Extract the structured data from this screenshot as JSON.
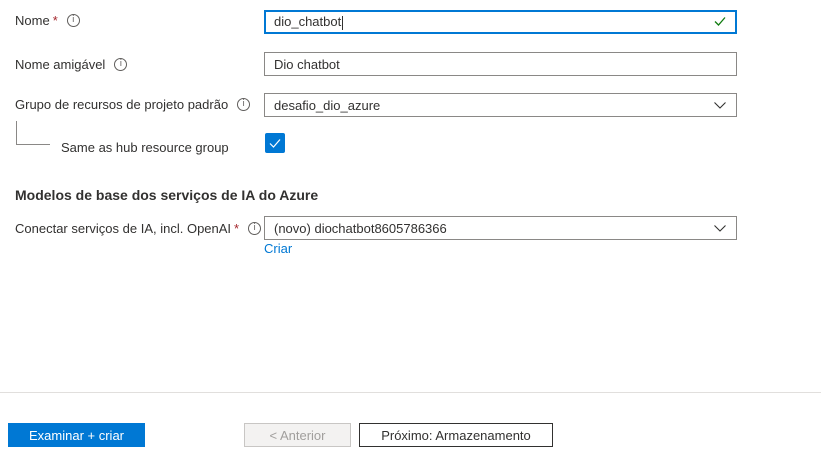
{
  "form": {
    "name": {
      "label": "Nome",
      "required_mark": "*",
      "info_icon": "ⓘ",
      "value": "dio_chatbot",
      "valid_icon": "checkmark-icon"
    },
    "friendly_name": {
      "label": "Nome amigável",
      "info_icon": "ⓘ",
      "value": "Dio chatbot"
    },
    "resource_group": {
      "label": "Grupo de recursos de projeto padrão",
      "info_icon": "ⓘ",
      "value": "desafio_dio_azure"
    },
    "hub_checkbox": {
      "label": "Same as hub resource group",
      "checked": true
    },
    "ai_section": {
      "title": "Modelos de base dos serviços de IA do Azure",
      "connect": {
        "label": "Conectar serviços de IA, incl. OpenAI",
        "required_mark": "*",
        "info_icon": "ⓘ",
        "value": "(novo) diochatbot8605786366"
      },
      "create_link": "Criar"
    }
  },
  "footer": {
    "review_create": "Examinar + criar",
    "previous": "< Anterior",
    "next": "Próximo: Armazenamento"
  },
  "colors": {
    "accent": "#0078d4",
    "success": "#107c10",
    "required": "#a4262c"
  }
}
